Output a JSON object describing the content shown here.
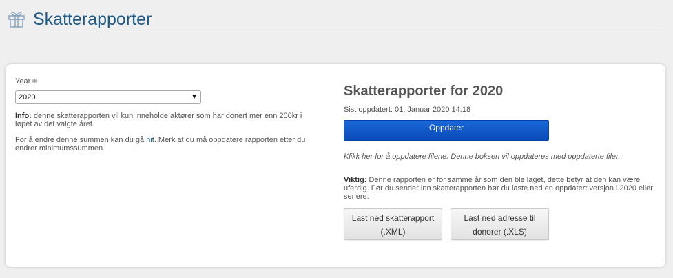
{
  "header": {
    "title": "Skatterapporter"
  },
  "form": {
    "year_label": "Year",
    "required_mark": "✱",
    "year_value": "2020",
    "info_label": "Info:",
    "info_text": " denne skatterapporten vil kun inneholde aktører som har donert mer enn 200kr i løpet av det valgte året.",
    "change_text_before": "For å endre denne summen kan du gå ",
    "change_link": "hit",
    "change_text_after": ". Merk at du må oppdatere rapporten etter du endrer minimumssummen."
  },
  "report": {
    "title": "Skatterapporter for 2020",
    "updated": "Sist oppdatert: 01. Januar 2020 14:18",
    "update_button": "Oppdater",
    "note": "Klikk her for å oppdatere filene. Denne boksen vil oppdateres med oppdaterte filer.",
    "important_label": "Viktig:",
    "important_text": " Denne rapporten er for samme år som den ble laget, dette betyr at den kan være uferdig. Før du sender inn skatterapporten bør du laste ned en oppdatert versjon i 2020 eller senere.",
    "download_xml": "Last ned skatterapport (.XML)",
    "download_xls": "Last ned adresse til donorer (.XLS)"
  },
  "colors": {
    "accent": "#1f5a85",
    "button_blue": "#0a55c8"
  }
}
